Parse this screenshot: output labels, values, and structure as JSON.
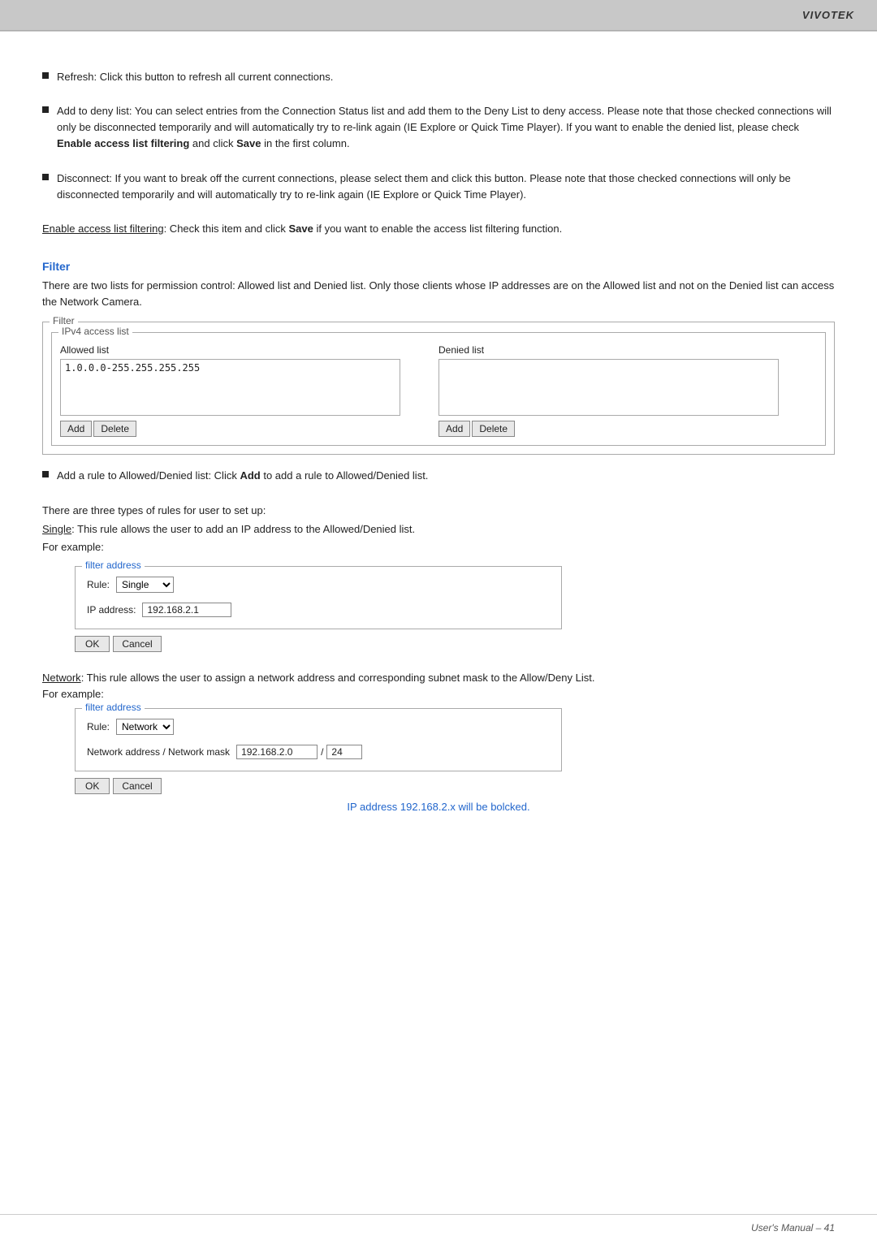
{
  "header": {
    "logo": "VIVOTEK"
  },
  "bullets": [
    {
      "id": "refresh",
      "text_before": "Refresh: Click this button to refresh all current connections."
    },
    {
      "id": "add-deny",
      "text_before": "Add to deny list: You can select entries from the Connection Status list and add them to the Deny List to deny access. Please note that those checked connections will only be disconnected temporarily and will automatically try to re-link again (IE Explore or Quick Time Player). If you want to enable the denied list, please check ",
      "bold1": "Enable access list filtering",
      "text_middle": " and click ",
      "bold2": "Save",
      "text_after": " in the first column."
    },
    {
      "id": "disconnect",
      "text_before": "Disconnect: If you want to break off the current connections, please select them and click this button. Please note that those checked connections will only be disconnected temporarily and will automatically try to re-link again (IE Explore or Quick Time Player)."
    }
  ],
  "enable_access": {
    "underline": "Enable access list filtering",
    "text": ": Check this item and click ",
    "bold": "Save",
    "text_after": " if you want to enable the access list filtering function."
  },
  "filter_section": {
    "heading": "Filter",
    "desc": "There are two lists for permission control: Allowed list and Denied list. Only those clients whose IP addresses are on the Allowed list and not on the Denied list can access the Network Camera.",
    "box_legend": "Filter",
    "ipv4_legend": "IPv4 access list",
    "allowed_label": "Allowed list",
    "denied_label": "Denied list",
    "allowed_value": "1.0.0.0-255.255.255.255",
    "add_btn": "Add",
    "delete_btn": "Delete"
  },
  "add_rule": {
    "text": "Add a rule to Allowed/Denied list: Click ",
    "bold": "Add",
    "text_after": " to add a rule to Allowed/Denied list."
  },
  "three_types": {
    "intro": "There are three types of rules for user to set up:",
    "single_label": "Single",
    "single_desc": ": This rule allows the user to add an IP address to the Allowed/Denied list.",
    "for_example": "For example:"
  },
  "filter_address_single": {
    "title": "filter address",
    "rule_label": "Rule:",
    "rule_value": "Single",
    "ip_label": "IP address:",
    "ip_value": "192.168.2.1",
    "ok_label": "OK",
    "cancel_label": "Cancel"
  },
  "network_section": {
    "network_label": "Network",
    "desc": ": This rule allows the user to assign a network address and corresponding subnet mask to the Allow/Deny List.",
    "for_example": "For example:"
  },
  "filter_address_network": {
    "title": "filter address",
    "rule_label": "Rule:",
    "rule_value": "Network",
    "net_label": "Network address / Network mask",
    "net_value": "192.168.2.0",
    "mask_value": "24",
    "slash": "/",
    "ok_label": "OK",
    "cancel_label": "Cancel"
  },
  "ip_note": "IP address 192.168.2.x will be bolcked.",
  "footer": {
    "text": "User's Manual – 41"
  }
}
